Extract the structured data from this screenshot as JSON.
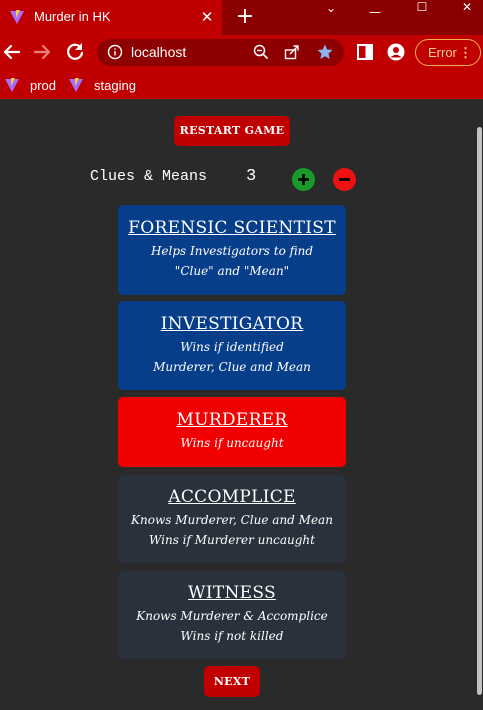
{
  "browser": {
    "tab_title": "Murder in HK",
    "tab_close": "✕",
    "new_tab": "+",
    "window_controls": {
      "minimize": "—",
      "maximize": "☐",
      "close": "✕",
      "dropdown": "⌄"
    },
    "url": "localhost",
    "error_label": "Error",
    "error_menu": "⋮",
    "bookmarks": [
      {
        "label": "prod"
      },
      {
        "label": "staging"
      }
    ],
    "colors": {
      "frame": "#8b0000",
      "toolbar": "#c00000",
      "omnibox": "#8e0000",
      "accent_star": "#8ab4f8"
    }
  },
  "game": {
    "restart_label": "RESTART GAME",
    "clues_label": "Clues & Means",
    "clues_count": "3",
    "plus_label": "+",
    "minus_label": "−",
    "roles": [
      {
        "title": "FORENSIC SCIENTIST",
        "lines": [
          "Helps Investigators to find",
          "\"Clue\" and \"Mean\""
        ],
        "color": "#073e8a"
      },
      {
        "title": "INVESTIGATOR",
        "lines": [
          "Wins if identified",
          "Murderer, Clue and Mean"
        ],
        "color": "#073e8a"
      },
      {
        "title": "MURDERER",
        "lines": [
          "Wins if uncaught"
        ],
        "color": "#f00000"
      },
      {
        "title": "ACCOMPLICE",
        "lines": [
          "Knows Murderer, Clue and Mean",
          "Wins if Murderer uncaught"
        ],
        "color": "#28313c"
      },
      {
        "title": "WITNESS",
        "lines": [
          "Knows Murderer & Accomplice",
          "Wins if not killed"
        ],
        "color": "#28313c"
      }
    ],
    "next_label": "NEXT"
  }
}
